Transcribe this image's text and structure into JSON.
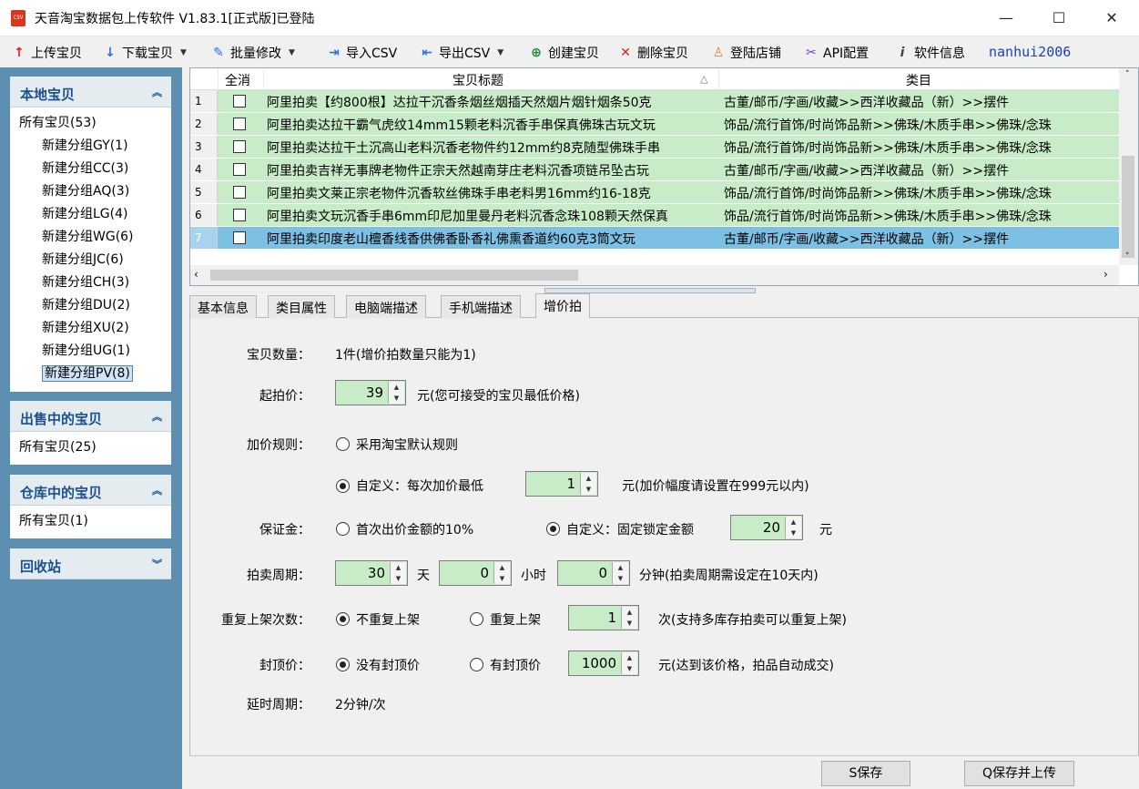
{
  "window": {
    "title": "天音淘宝数据包上传软件 V1.83.1[正式版]已登陆",
    "icon_label": "CSV",
    "minimize": "—",
    "maximize": "☐",
    "close": "✕"
  },
  "toolbar": {
    "upload": "上传宝贝",
    "download": "下载宝贝",
    "batch_edit": "批量修改",
    "import_csv": "导入CSV",
    "export_csv": "导出CSV",
    "create": "创建宝贝",
    "delete": "删除宝贝",
    "login_shop": "登陆店铺",
    "api_config": "API配置",
    "software_info": "软件信息",
    "username": "nanhui2006"
  },
  "sidebar": {
    "local": {
      "title": "本地宝贝",
      "all": "所有宝贝(53)",
      "groups": [
        "新建分组GY(1)",
        "新建分组CC(3)",
        "新建分组AQ(3)",
        "新建分组LG(4)",
        "新建分组WG(6)",
        "新建分组JC(6)",
        "新建分组CH(3)",
        "新建分组DU(2)",
        "新建分组XU(2)",
        "新建分组UG(1)",
        "新建分组PV(8)"
      ]
    },
    "on_sale": {
      "title": "出售中的宝贝",
      "all": "所有宝贝(25)"
    },
    "warehouse": {
      "title": "仓库中的宝贝",
      "all": "所有宝贝(1)"
    },
    "recycle": {
      "title": "回收站"
    }
  },
  "grid": {
    "headers": {
      "check_all": "全消",
      "title": "宝贝标题",
      "sort": "△",
      "category": "类目"
    },
    "rows": [
      {
        "n": "1",
        "title": "阿里拍卖【约800根】达拉干沉香条烟丝烟插天然烟片烟针烟条50克",
        "category": "古董/邮币/字画/收藏>>西洋收藏品（新）>>摆件"
      },
      {
        "n": "2",
        "title": "阿里拍卖达拉干霸气虎纹14mm15颗老料沉香手串保真佛珠古玩文玩",
        "category": "饰品/流行首饰/时尚饰品新>>佛珠/木质手串>>佛珠/念珠"
      },
      {
        "n": "3",
        "title": "阿里拍卖达拉干土沉高山老料沉香老物件约12mm约8克随型佛珠手串",
        "category": "饰品/流行首饰/时尚饰品新>>佛珠/木质手串>>佛珠/念珠"
      },
      {
        "n": "4",
        "title": "阿里拍卖吉祥无事牌老物件正宗天然越南芽庄老料沉香项链吊坠古玩",
        "category": "古董/邮币/字画/收藏>>西洋收藏品（新）>>摆件"
      },
      {
        "n": "5",
        "title": "阿里拍卖文莱正宗老物件沉香软丝佛珠手串老料男16mm约16-18克",
        "category": "饰品/流行首饰/时尚饰品新>>佛珠/木质手串>>佛珠/念珠"
      },
      {
        "n": "6",
        "title": "阿里拍卖文玩沉香手串6mm印尼加里曼丹老料沉香念珠108颗天然保真",
        "category": "饰品/流行首饰/时尚饰品新>>佛珠/木质手串>>佛珠/念珠"
      },
      {
        "n": "7",
        "title": "阿里拍卖印度老山檀香线香供佛香卧香礼佛熏香道约60克3筒文玩",
        "category": "古董/邮币/字画/收藏>>西洋收藏品（新）>>摆件"
      }
    ]
  },
  "tabs": [
    "基本信息",
    "类目属性",
    "电脑端描述",
    "手机端描述",
    "增价拍"
  ],
  "form": {
    "qty_label": "宝贝数量：",
    "qty_value": "1件(增价拍数量只能为1)",
    "start_label": "起拍价：",
    "start_value": "39",
    "start_note": "元(您可接受的宝贝最低价格)",
    "rule_label": "加价规则：",
    "rule_default": "采用淘宝默认规则",
    "rule_custom": "自定义：每次加价最低",
    "rule_value": "1",
    "rule_note": "元(加价幅度请设置在999元以内)",
    "deposit_label": "保证金：",
    "deposit_opt1": "首次出价金额的10%",
    "deposit_opt2": "自定义：固定锁定金额",
    "deposit_value": "20",
    "deposit_unit": "元",
    "period_label": "拍卖周期：",
    "period_days": "30",
    "period_day_unit": "天",
    "period_hours": "0",
    "period_hour_unit": "小时",
    "period_minutes": "0",
    "period_note": "分钟(拍卖周期需设定在10天内)",
    "relist_label": "重复上架次数：",
    "relist_no": "不重复上架",
    "relist_yes": "重复上架",
    "relist_value": "1",
    "relist_note": "次(支持多库存拍卖可以重复上架)",
    "cap_label": "封顶价：",
    "cap_no": "没有封顶价",
    "cap_yes": "有封顶价",
    "cap_value": "1000",
    "cap_note": "元(达到该价格，拍品自动成交)",
    "delay_label": "延时周期：",
    "delay_value": "2分钟/次"
  },
  "footer": {
    "save": "S保存",
    "save_upload": "Q保存并上传"
  },
  "colors": {
    "row_bg": "#c9ecc8",
    "row_selected": "#7cc0e4",
    "sidebar_bg": "#5c8fb0",
    "panel_title": "#1b4f8e"
  }
}
